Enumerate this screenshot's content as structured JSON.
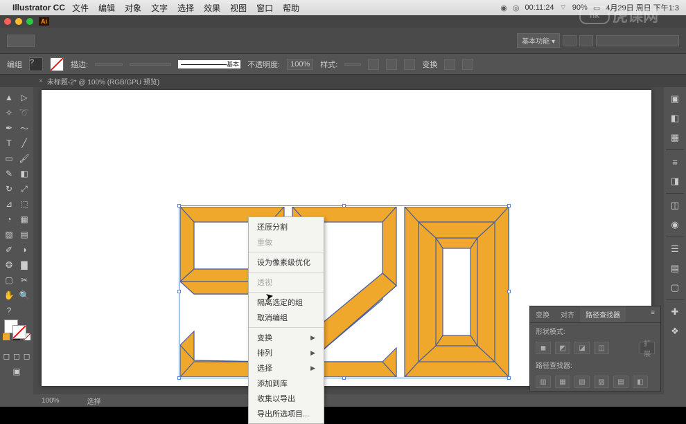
{
  "mac": {
    "app": "Illustrator CC",
    "menu": [
      "文件",
      "编辑",
      "对象",
      "文字",
      "选择",
      "效果",
      "视图",
      "窗口",
      "帮助"
    ],
    "time": "00:11:24",
    "battery": "90%",
    "date": "4月29日 周日 下午1:3"
  },
  "controlbar": {
    "label": "基本功能"
  },
  "options": {
    "group": "编组",
    "stroke_label": "描边:",
    "line_label": "基本",
    "opacity_label": "不透明度:",
    "opacity_value": "100%",
    "style_label": "样式:",
    "transform": "变换"
  },
  "tab": {
    "close": "×",
    "title": "未标题-2* @ 100% (RGB/GPU 预览)"
  },
  "context": {
    "undo": "还原分割",
    "redo": "重做",
    "pixel": "设为像素级优化",
    "perspective": "透视",
    "isolate": "隔离选定的组",
    "ungroup": "取消编组",
    "transform": "变换",
    "arrange": "排列",
    "select": "选择",
    "addlib": "添加到库",
    "collect": "收集以导出",
    "export": "导出所选项目..."
  },
  "pathfinder": {
    "tab_transform": "变换",
    "tab_align": "对齐",
    "tab_pathfinder": "路径查找器",
    "shape_modes": "形状模式:",
    "expand": "扩展",
    "pathfinders": "路径查找器:"
  },
  "status": {
    "zoom": "100%",
    "tool": "选择"
  },
  "watermark": {
    "text": "虎课网"
  }
}
